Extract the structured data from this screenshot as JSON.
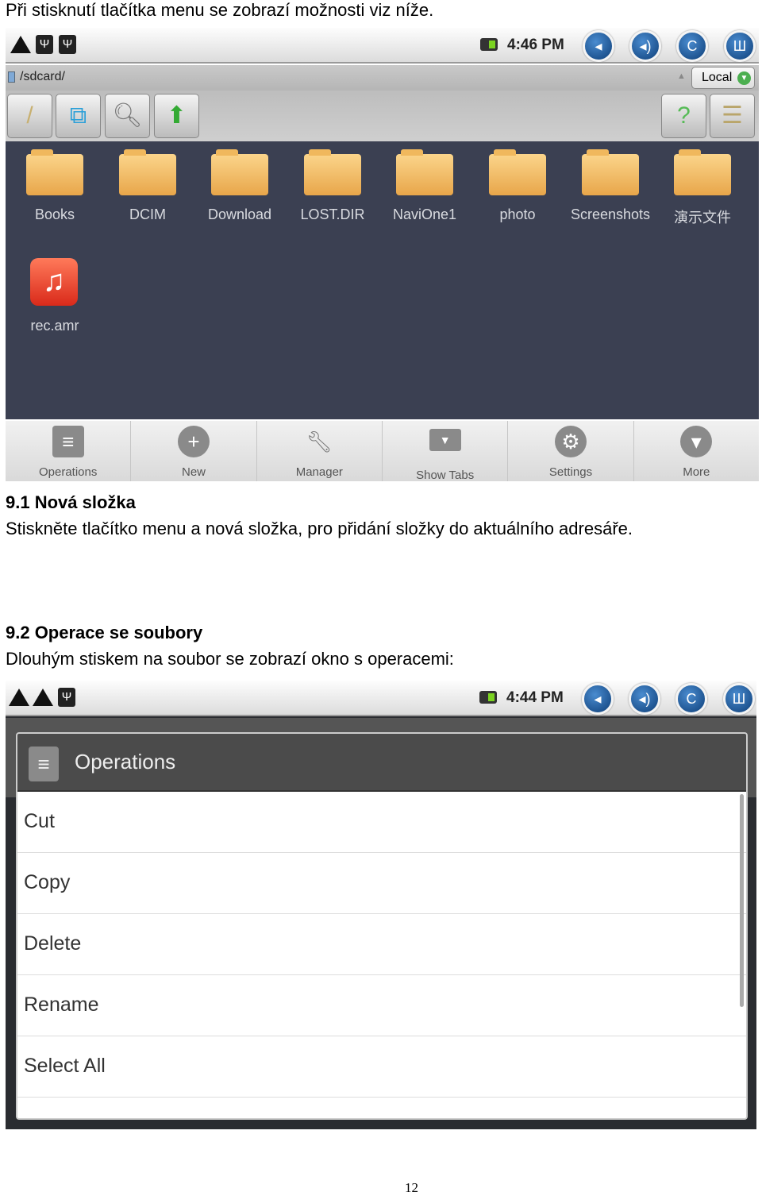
{
  "intro": "Při stisknutí tlačítka menu se zobrazí možnosti viz níže.",
  "screen1": {
    "clock": "4:46 PM",
    "path": "/sdcard/",
    "storage": "Local",
    "folders": [
      "Books",
      "DCIM",
      "Download",
      "LOST.DIR",
      "NaviOne1",
      "photo",
      "Screenshots",
      "演示文件"
    ],
    "file": "rec.amr",
    "menu": [
      "Operations",
      "New",
      "Manager",
      "Show Tabs",
      "Settings",
      "More"
    ]
  },
  "section1": {
    "title": "9.1 Nová složka",
    "text": "Stiskněte tlačítko menu a nová složka, pro přidání složky do aktuálního adresáře."
  },
  "section2": {
    "title": "9.2 Operace se soubory",
    "text": "Dlouhým stiskem na soubor se zobrazí okno s operacemi:"
  },
  "screen2": {
    "clock": "4:44 PM",
    "dialog_title": "Operations",
    "items": [
      "Cut",
      "Copy",
      "Delete",
      "Rename",
      "Select All"
    ]
  },
  "page_number": "12"
}
